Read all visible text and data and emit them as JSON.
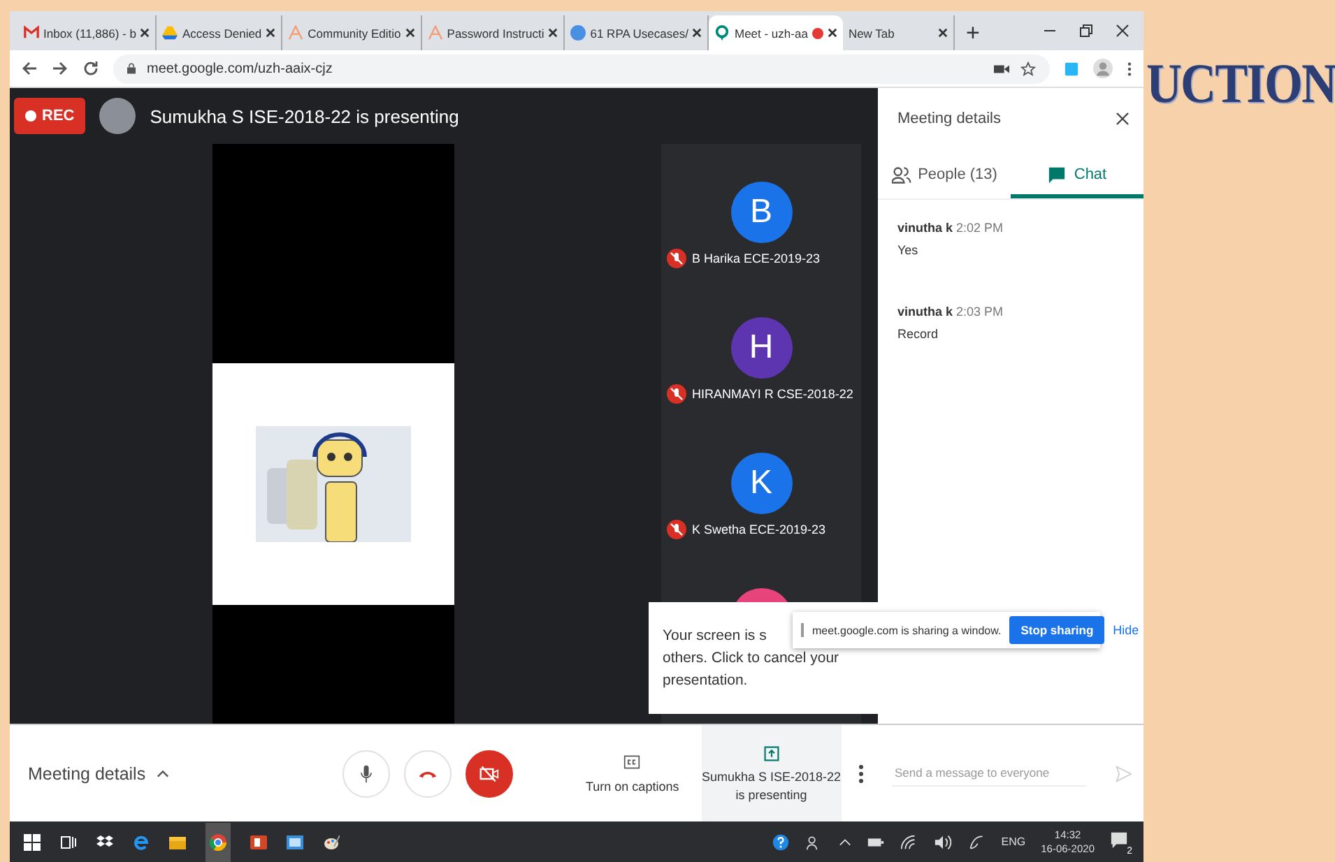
{
  "browser": {
    "tabs": [
      {
        "title": "Inbox (11,886) - b",
        "selected": false,
        "recording": false
      },
      {
        "title": "Access Denied",
        "selected": false,
        "recording": false
      },
      {
        "title": "Community Editio",
        "selected": false,
        "recording": false
      },
      {
        "title": "Password Instructi",
        "selected": false,
        "recording": false
      },
      {
        "title": "61 RPA Usecases/",
        "selected": false,
        "recording": false
      },
      {
        "title": "Meet - uzh-aa",
        "selected": true,
        "recording": true
      },
      {
        "title": "New Tab",
        "selected": false,
        "recording": false
      }
    ],
    "new_tab_button": "+",
    "url": "meet.google.com/uzh-aaix-cjz"
  },
  "meet": {
    "rec_label": "REC",
    "presenter_banner": "Sumukha S ISE-2018-22 is presenting",
    "participants": [
      {
        "initial": "B",
        "name": "B Harika ECE-2019-23",
        "color": "#1a73e8",
        "muted": true
      },
      {
        "initial": "H",
        "name": "HIRANMAYI R CSE-2018-22",
        "color": "#5e35b1",
        "muted": true
      },
      {
        "initial": "K",
        "name": "K Swetha ECE-2019-23",
        "color": "#1a73e8",
        "muted": true
      },
      {
        "color": "#e8437b"
      }
    ],
    "popover": {
      "lines": [
        "Your screen is s",
        "others. Click to cancel your",
        "presentation."
      ]
    },
    "share_bar": {
      "message": "meet.google.com is sharing a window.",
      "stop_button": "Stop sharing",
      "hide_link": "Hide"
    }
  },
  "controls": {
    "meeting_details": "Meeting details",
    "mic_on": true,
    "camera_on": false,
    "captions": "Turn on captions",
    "present_lines": [
      "Sumukha S ISE-2018-22",
      "is presenting"
    ]
  },
  "panel": {
    "title": "Meeting details",
    "tabs": [
      {
        "label": "People (13)",
        "kind": "people",
        "selected": false
      },
      {
        "label": "Chat",
        "kind": "chat",
        "selected": true
      }
    ],
    "messages": [
      {
        "sender": "vinutha k",
        "time": "2:02 PM",
        "text": "Yes"
      },
      {
        "sender": "vinutha k",
        "time": "2:03 PM",
        "text": "Record"
      }
    ],
    "input": {
      "placeholder": "Send a message to everyone"
    }
  },
  "taskbar": {
    "language": "ENG",
    "time": "14:32",
    "date": "16-06-2020",
    "notifications": "2"
  },
  "slide_heading": "UCTION"
}
